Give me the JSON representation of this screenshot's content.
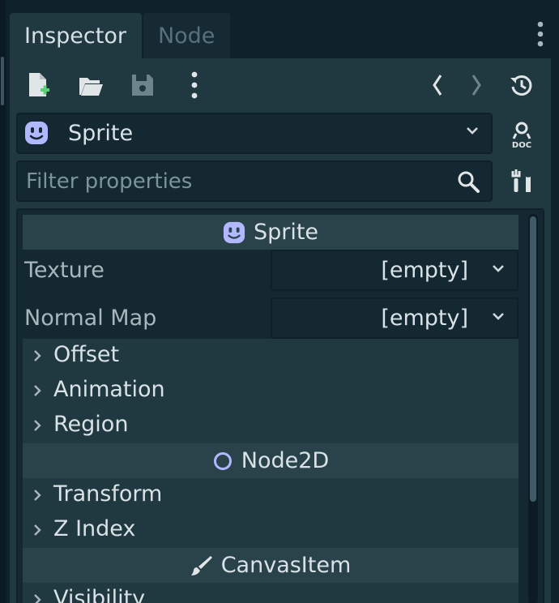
{
  "tabs": [
    {
      "label": "Inspector",
      "active": true
    },
    {
      "label": "Node",
      "active": false
    }
  ],
  "node_selector": {
    "title": "Sprite",
    "icon": "sprite-face-icon"
  },
  "filter": {
    "placeholder": "Filter properties"
  },
  "sections": {
    "sprite": {
      "label": "Sprite",
      "icon": "sprite-face-icon"
    },
    "node2d": {
      "label": "Node2D",
      "icon": "node2d-circle-icon"
    },
    "canvasitem": {
      "label": "CanvasItem",
      "icon": "brush-icon"
    }
  },
  "properties": {
    "texture": {
      "label": "Texture",
      "value": "[empty]"
    },
    "normal_map": {
      "label": "Normal Map",
      "value": "[empty]"
    }
  },
  "groups": {
    "offset": "Offset",
    "animation": "Animation",
    "region": "Region",
    "transform": "Transform",
    "z_index": "Z Index",
    "visibility": "Visibility"
  },
  "doc_label": "DOC",
  "colors": {
    "background": "#0f222c",
    "panel": "#20383f",
    "field": "#142832",
    "section_header": "#2a434b",
    "text": "#d9e2e6",
    "muted_text": "#a9b7bc",
    "accent_icon": "#b1b8ff",
    "new_file_plus": "#5fd07a"
  }
}
